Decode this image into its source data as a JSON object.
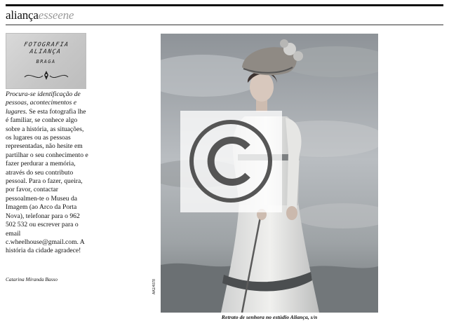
{
  "masthead": {
    "part1": "aliança",
    "part2": "esseene"
  },
  "logo": {
    "line1": "FOTOGRAFIA ALIANÇA",
    "line2": "BRAGA",
    "ornament": "scroll-ornament-icon"
  },
  "blurb": {
    "lead_italic": "Procura-se identificação de pessoas, acontecimentos e lugares.",
    "body": " Se esta fotografia lhe é familiar, se conhece algo sobre a história, as situações, os lugares ou as pessoas representadas, não hesite em partilhar o seu conhecimento e fazer perdurar a memória, através do seu contributo pessoal. Para o fazer, queira, por favor, contactar pessoalmen-te o Museu da Imagem (ao Arco da Porta Nova), telefonar para o 962 502 532 ou escrever para o email c.wheelhouse@gmail.com. A história da cidade agradece!"
  },
  "author": "Catarina Miranda Basso",
  "photo": {
    "id_label": "AA1/4078",
    "watermark": "copyright-icon",
    "caption": "Retrato de senhora no estúdio Aliança, s/n"
  },
  "colors": {
    "rule": "#111111",
    "masthead_accent": "#9a9a9a"
  }
}
